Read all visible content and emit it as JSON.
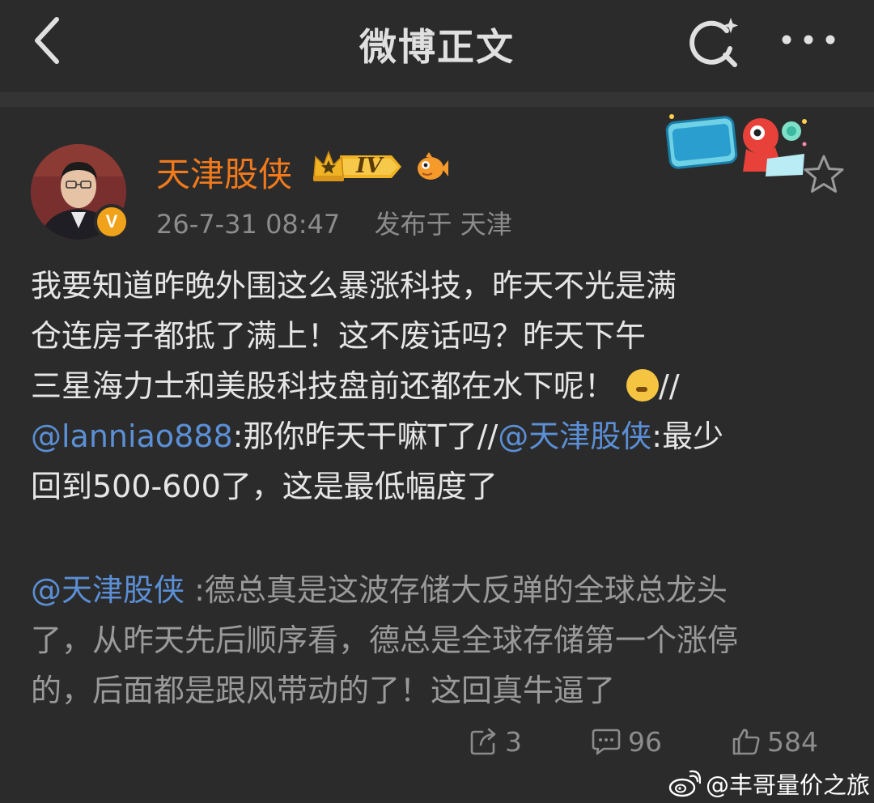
{
  "header": {
    "title": "微博正文"
  },
  "post": {
    "author": {
      "name": "天津股侠",
      "verified_mark": "V",
      "level_badge": "IV"
    },
    "meta": {
      "timestamp": "26-7-31 08:47",
      "location": "发布于 天津"
    },
    "body": {
      "line1": "我要知道昨晚外围这么暴涨科技，昨天不光是满",
      "line2": "仓连房子都抵了满上！这不废话吗？昨天下午",
      "line3": "三星海力士和美股科技盘前还都在水下呢！",
      "line3_tail": "//",
      "mention1": "@lanniao888",
      "line4_text": ":那你昨天干嘛T了//",
      "mention2": "@天津股侠",
      "line4_tail": ":最少",
      "line5": "回到500-600了，这是最低幅度了"
    },
    "quote": {
      "mention": "@天津股侠",
      "line1_text": " :德总真是这波存储大反弹的全球总龙头",
      "line2": "了，从昨天先后顺序看，德总是全球存储第一个涨停",
      "line3": "的，后面都是跟风带动的了！这回真牛逼了"
    },
    "actions": {
      "reposts": "3",
      "comments": "96",
      "likes": "584"
    }
  },
  "watermark": {
    "text": "@丰哥量价之旅"
  },
  "colors": {
    "background": "#2b2b2b",
    "username": "#f27a1c",
    "mention": "#5b8fd6",
    "verified": "#f0a21b"
  },
  "icons": [
    "back-arrow-icon",
    "search-sparkle-icon",
    "more-dots-icon",
    "crown-icon",
    "fish-icon",
    "star-icon",
    "repost-icon",
    "comment-icon",
    "like-icon",
    "weibo-logo-icon"
  ]
}
